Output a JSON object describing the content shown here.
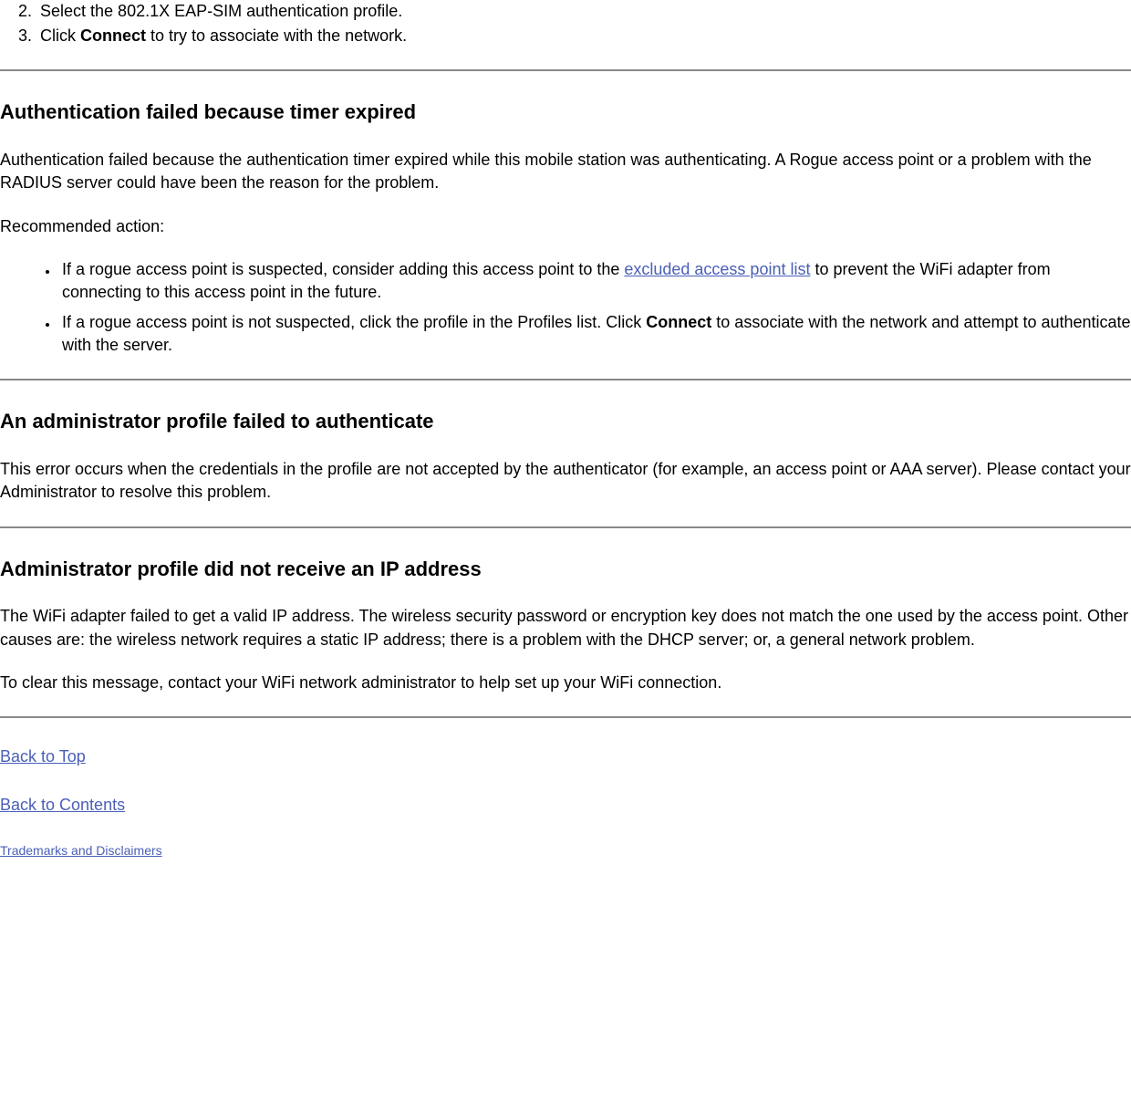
{
  "ordered_list": {
    "item2": "Select the 802.1X EAP-SIM authentication profile.",
    "item3_prefix": "Click ",
    "item3_bold": "Connect",
    "item3_suffix": " to try to associate with the network."
  },
  "section1": {
    "heading": "Authentication failed because timer expired",
    "para1": "Authentication failed because the authentication timer expired while this mobile station was authenticating. A Rogue access point or a problem with the RADIUS server could have been the reason for the problem.",
    "para2": "Recommended action:",
    "bullet1_prefix": "If a rogue access point is suspected, consider adding this access point to the ",
    "bullet1_link": "excluded access point list",
    "bullet1_suffix": " to prevent the WiFi adapter from connecting to this access point in the future.",
    "bullet2_prefix": "If a rogue access point is not suspected, click the profile in the Profiles list. Click ",
    "bullet2_bold": "Connect",
    "bullet2_suffix": " to associate with the network and attempt to authenticate with the server."
  },
  "section2": {
    "heading": "An administrator profile failed to authenticate",
    "para1": "This error occurs when the credentials in the profile are not accepted by the authenticator (for example, an access point or AAA server). Please contact your Administrator to resolve this problem."
  },
  "section3": {
    "heading": "Administrator profile did not receive an IP address",
    "para1": "The WiFi adapter failed to get a valid IP address. The wireless security password or encryption key does not match the one used by the access point. Other causes are: the wireless network requires a static IP address; there is a problem with the DHCP server; or, a general network problem.",
    "para2": "To clear this message, contact your WiFi network administrator to help set up your WiFi connection."
  },
  "nav": {
    "back_to_top": "Back to Top",
    "back_to_contents": "Back to Contents",
    "trademarks": "Trademarks and Disclaimers"
  }
}
